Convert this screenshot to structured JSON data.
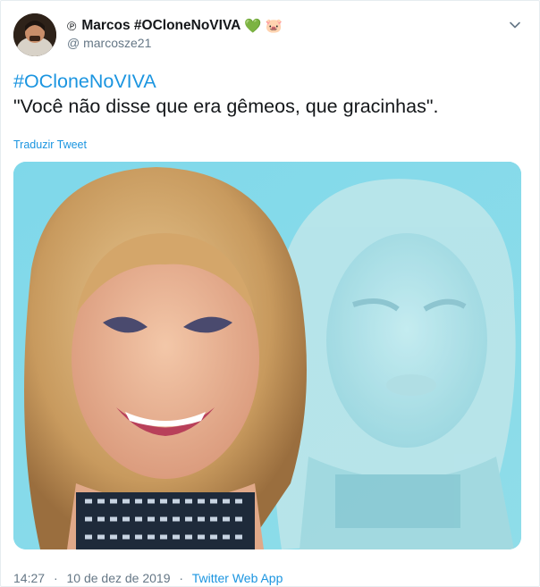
{
  "author": {
    "symbol": "℗",
    "display_name": "Marcos #OCloneNoVIVA",
    "emojis": [
      "💚",
      "🐷"
    ],
    "screen_name": "@ marcosze21"
  },
  "tweet": {
    "hashtag": "#OCloneNoVIVA",
    "text": "\"Você não disse que era gêmeos, que gracinhas\".",
    "translate_link": "Traduzir Tweet"
  },
  "footer": {
    "time": "14:27",
    "separator": "·",
    "date": "10 de dez de 2019",
    "source": "Twitter Web App"
  },
  "icons": {
    "menu": "chevron-down-icon"
  },
  "colors": {
    "link": "#1b95e0",
    "secondary_text": "#657786",
    "media_background": "#7fd6e8"
  }
}
